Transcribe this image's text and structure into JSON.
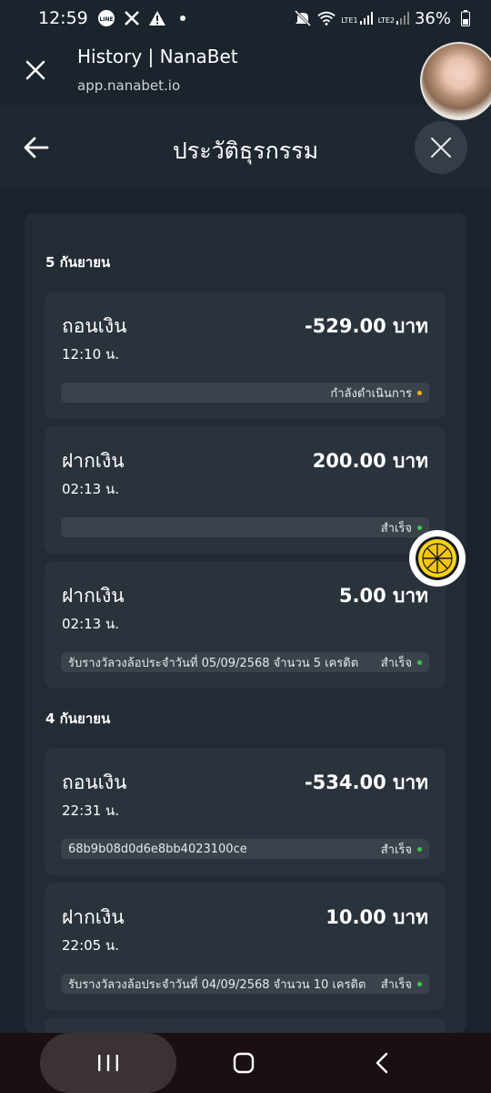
{
  "status_bar": {
    "time": "12:59",
    "icons": [
      "line-icon",
      "x-icon",
      "warning-icon",
      "dot-icon"
    ],
    "right_icons": [
      "mute-icon",
      "wifi-icon",
      "signal-lte1-icon",
      "signal-lte2-icon",
      "battery-icon"
    ],
    "lte1": "LTE1",
    "lte2": "LTE2",
    "battery": "36%"
  },
  "browser": {
    "title": "History | NanaBet",
    "url": "app.nanabet.io"
  },
  "header": {
    "title": "ประวัติธุรกรรม"
  },
  "colors": {
    "status_pending": "#f0b400",
    "status_success": "#3ec84a"
  },
  "groups": [
    {
      "date": "5 กันยายน",
      "transactions": [
        {
          "type": "ถอนเงิน",
          "amount": "-529.00 บาท",
          "time": "12:10 น.",
          "note": "",
          "status": "กำลังดำเนินการ",
          "status_kind": "pending"
        },
        {
          "type": "ฝากเงิน",
          "amount": "200.00 บาท",
          "time": "02:13 น.",
          "note": "",
          "status": "สำเร็จ",
          "status_kind": "success"
        },
        {
          "type": "ฝากเงิน",
          "amount": "5.00 บาท",
          "time": "02:13 น.",
          "note": "รับรางวัลวงล้อประจำวันที่ 05/09/2568 จำนวน 5 เครดิต",
          "status": "สำเร็จ",
          "status_kind": "success"
        }
      ]
    },
    {
      "date": "4 กันยายน",
      "transactions": [
        {
          "type": "ถอนเงิน",
          "amount": "-534.00 บาท",
          "time": "22:31 น.",
          "note": "68b9b08d0d6e8bb4023100ce",
          "status": "สำเร็จ",
          "status_kind": "success"
        },
        {
          "type": "ฝากเงิน",
          "amount": "10.00 บาท",
          "time": "22:05 น.",
          "note": "รับรางวัลวงล้อประจำวันที่ 04/09/2568 จำนวน 10 เครดิต",
          "status": "สำเร็จ",
          "status_kind": "success"
        }
      ]
    }
  ],
  "nav": {
    "icons": [
      "recent-apps-icon",
      "home-icon",
      "back-icon"
    ]
  }
}
